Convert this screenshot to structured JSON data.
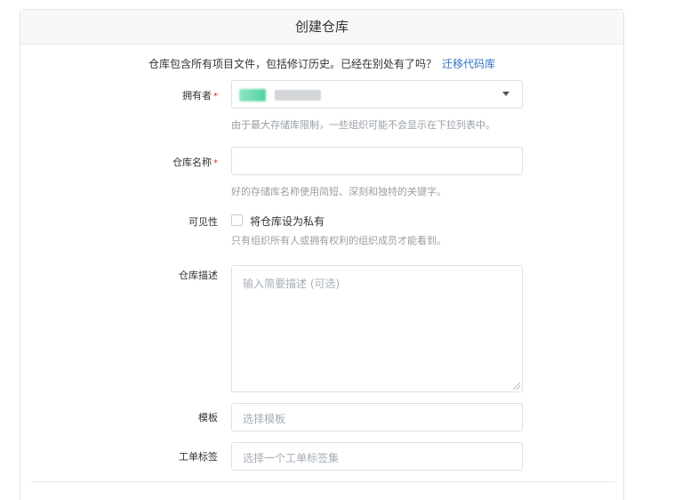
{
  "header": {
    "title": "创建仓库"
  },
  "intro": {
    "text": "仓库包含所有项目文件，包括修订历史。已经在别处有了吗？",
    "link": "迁移代码库"
  },
  "form": {
    "owner": {
      "label": "拥有者",
      "required": "*",
      "help": "由于最大存储库限制，一些组织可能不会显示在下拉列表中。"
    },
    "repo_name": {
      "label": "仓库名称",
      "required": "*",
      "value": "",
      "help": "好的存储库名称使用简短、深刻和独特的关键字。"
    },
    "visibility": {
      "label": "可见性",
      "checkbox_label": "将仓库设为私有",
      "checked": false,
      "help": "只有组织所有人或拥有权利的组织成员才能看到。"
    },
    "description": {
      "label": "仓库描述",
      "placeholder": "输入简要描述 (可选)"
    },
    "template": {
      "label": "模板",
      "placeholder": "选择模板"
    },
    "issue_labels": {
      "label": "工单标签",
      "placeholder": "选择一个工单标签集"
    }
  },
  "icons": {
    "dropdown": "caret-down-icon",
    "resize": "resize-handle-icon"
  },
  "colors": {
    "link": "#2f74c0",
    "required": "#db2828",
    "header_bg": "#f7f8f9"
  }
}
